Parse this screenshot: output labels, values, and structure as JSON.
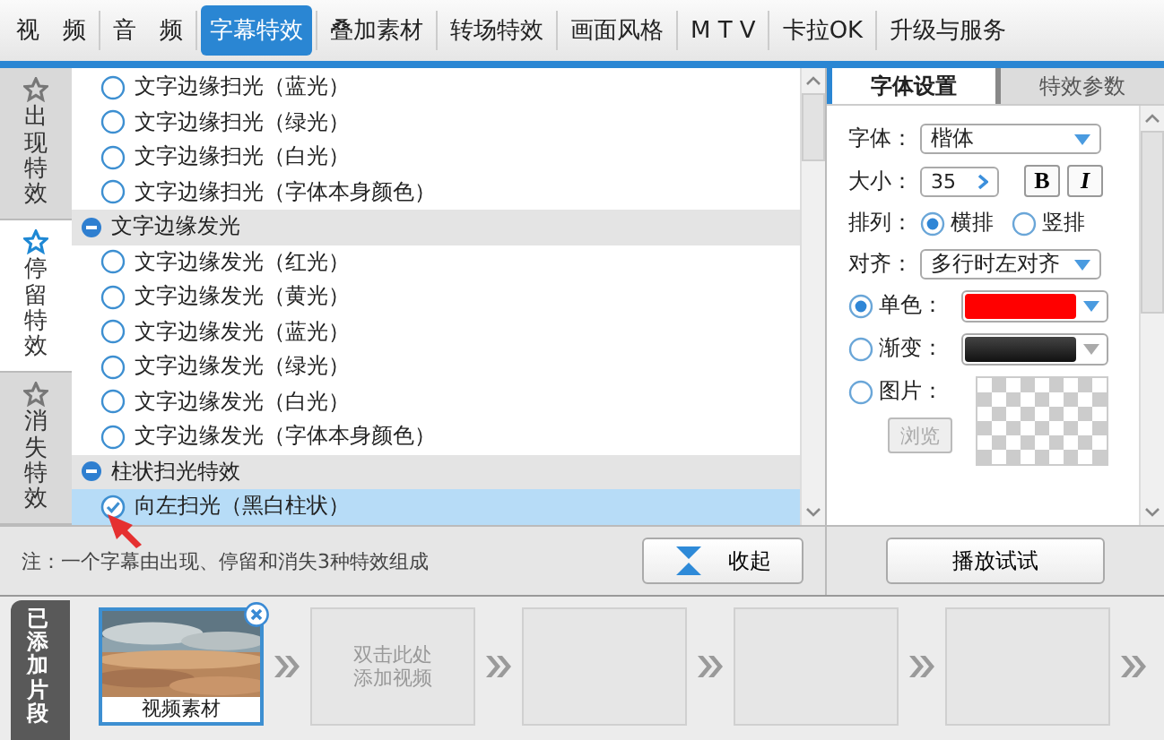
{
  "tabs": [
    {
      "label": "视　频",
      "selected": false
    },
    {
      "label": "音　频",
      "selected": false
    },
    {
      "label": "字幕特效",
      "selected": true
    },
    {
      "label": "叠加素材",
      "selected": false
    },
    {
      "label": "转场特效",
      "selected": false
    },
    {
      "label": "画面风格",
      "selected": false
    },
    {
      "label": "M T V",
      "selected": false
    },
    {
      "label": "卡拉OK",
      "selected": false
    },
    {
      "label": "升级与服务",
      "selected": false
    }
  ],
  "side_tabs": [
    {
      "label": "出现特效",
      "selected": false
    },
    {
      "label": "停留特效",
      "selected": true
    },
    {
      "label": "消失特效",
      "selected": false
    }
  ],
  "effect_list": [
    {
      "kind": "item",
      "label": "文字边缘扫光（蓝光）",
      "selected": false
    },
    {
      "kind": "item",
      "label": "文字边缘扫光（绿光）",
      "selected": false
    },
    {
      "kind": "item",
      "label": "文字边缘扫光（白光）",
      "selected": false
    },
    {
      "kind": "item",
      "label": "文字边缘扫光（字体本身颜色）",
      "selected": false
    },
    {
      "kind": "group",
      "label": "文字边缘发光",
      "expanded": true,
      "children": [
        {
          "label": "文字边缘发光（红光）",
          "selected": false
        },
        {
          "label": "文字边缘发光（黄光）",
          "selected": false
        },
        {
          "label": "文字边缘发光（蓝光）",
          "selected": false
        },
        {
          "label": "文字边缘发光（绿光）",
          "selected": false
        },
        {
          "label": "文字边缘发光（白光）",
          "selected": false
        },
        {
          "label": "文字边缘发光（字体本身颜色）",
          "selected": false
        }
      ]
    },
    {
      "kind": "group",
      "label": "柱状扫光特效",
      "expanded": true,
      "children": [
        {
          "label": "向左扫光（黑白柱状）",
          "selected": true
        }
      ]
    }
  ],
  "settings_tabs": [
    {
      "label": "字体设置",
      "selected": true
    },
    {
      "label": "特效参数",
      "selected": false
    }
  ],
  "font": {
    "label": "字体：",
    "value": "楷体"
  },
  "size": {
    "label": "大小：",
    "value": "35"
  },
  "bold_button": "B",
  "italic_button": "I",
  "arrangement": {
    "label": "排列：",
    "options": [
      {
        "label": "横排",
        "selected": true
      },
      {
        "label": "竖排",
        "selected": false
      }
    ]
  },
  "align": {
    "label": "对齐：",
    "value": "多行时左对齐"
  },
  "fills": [
    {
      "kind": "solid",
      "label": "单色：",
      "selected": true,
      "color": "#ff0000"
    },
    {
      "kind": "gradient",
      "label": "渐变：",
      "selected": false,
      "color": "#111111"
    },
    {
      "label": "图片：",
      "selected": false
    }
  ],
  "browse_button": {
    "label": "浏览",
    "disabled": true
  },
  "note": "注：一个字幕由出现、停留和消失3种特效组成",
  "collapse_button": "收起",
  "play_button": "播放试试",
  "timeline": {
    "label": "已添加片段",
    "clips": [
      {
        "kind": "video",
        "caption": "视频素材"
      },
      {
        "kind": "empty",
        "hint": [
          "双击此处",
          "添加视频"
        ]
      },
      {
        "kind": "empty"
      },
      {
        "kind": "empty"
      },
      {
        "kind": "empty"
      }
    ]
  }
}
